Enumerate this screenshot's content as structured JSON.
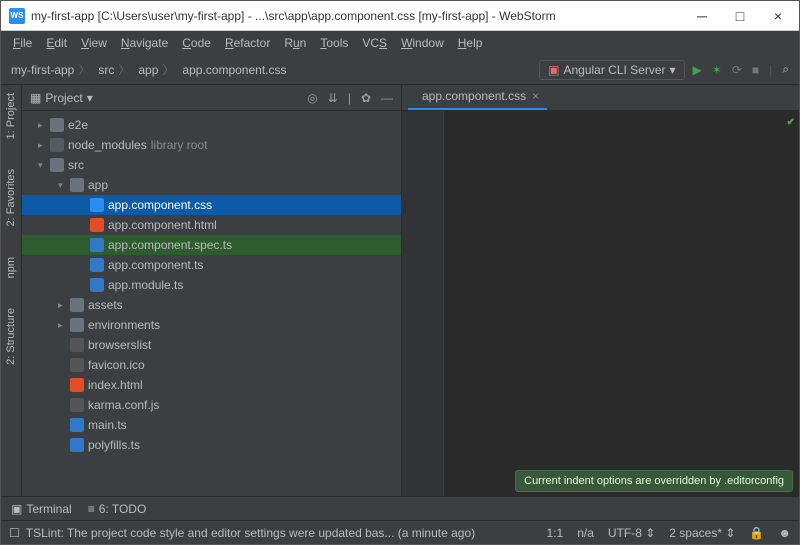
{
  "window_title": "my-first-app [C:\\Users\\user\\my-first-app] - ...\\src\\app\\app.component.css [my-first-app] - WebStorm",
  "logo_text": "WS",
  "menu": [
    "File",
    "Edit",
    "View",
    "Navigate",
    "Code",
    "Refactor",
    "Run",
    "Tools",
    "VCS",
    "Window",
    "Help"
  ],
  "breadcrumbs": [
    {
      "label": "my-first-app",
      "icon": "folder"
    },
    {
      "label": "src",
      "icon": "folder"
    },
    {
      "label": "app",
      "icon": "folder"
    },
    {
      "label": "app.component.css",
      "icon": "css"
    }
  ],
  "run_config": {
    "label": "Angular CLI Server",
    "icon": "▣"
  },
  "panel": {
    "title": "Project"
  },
  "tree": {
    "e2e": "e2e",
    "node_modules": "node_modules",
    "library_root": "library root",
    "src": "src",
    "app": "app",
    "files": {
      "css": "app.component.css",
      "html": "app.component.html",
      "spec": "app.component.spec.ts",
      "ts": "app.component.ts",
      "module": "app.module.ts"
    },
    "assets": "assets",
    "environments": "environments",
    "srcfiles": {
      "browserslist": "browserslist",
      "favicon": "favicon.ico",
      "index": "index.html",
      "karma": "karma.conf.js",
      "main": "main.ts",
      "polyfills": "polyfills.ts"
    }
  },
  "editor_tab": {
    "label": "app.component.css"
  },
  "tooltip": "Current indent options are overridden by .editorconfig",
  "bottom_tools": {
    "terminal": "Terminal",
    "todo": "6: TODO",
    "todo_icon": "≡"
  },
  "status": {
    "message": "TSLint: The project code style and editor settings were updated bas... (a minute ago)",
    "pos": "1:1",
    "na": "n/a",
    "encoding": "UTF-8",
    "indent": "2 spaces",
    "lock": "🔒"
  },
  "icons": {
    "folder": "▇",
    "run": "▶",
    "debug": "✶",
    "cov": "⟳",
    "stop": "■",
    "search": "⌕",
    "target": "◎",
    "collapse": "⇊",
    "divider": "|",
    "gear": "✿",
    "hide": "—",
    "chev_down": "▾",
    "chev_right": "▸",
    "close": "×",
    "tick": "✔",
    "updown": "⇕",
    "square": "□",
    "term": "▣"
  }
}
